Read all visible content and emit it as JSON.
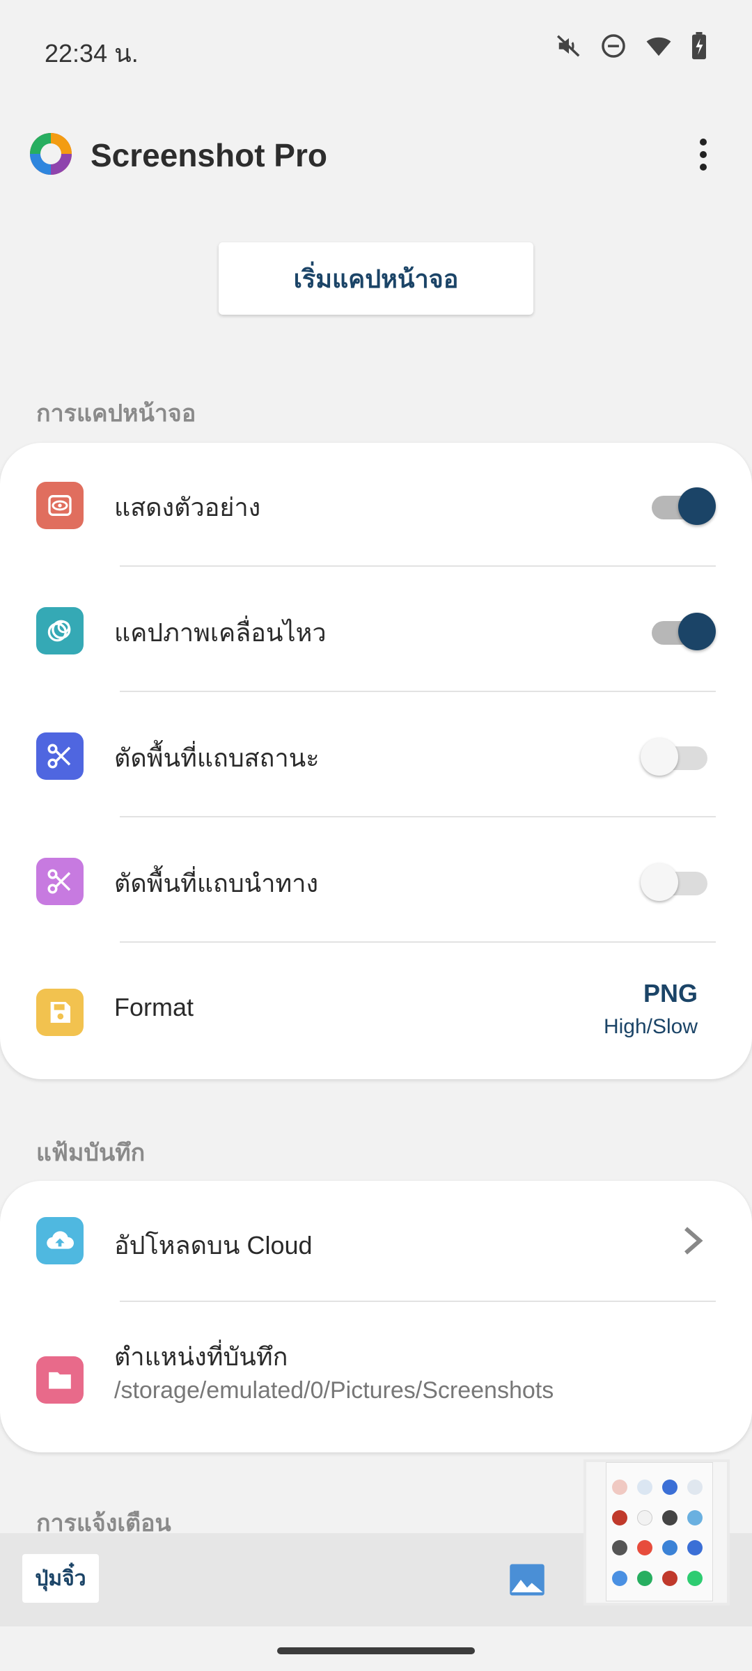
{
  "status_bar": {
    "time": "22:34 น.",
    "icons": [
      "mute-icon",
      "do-not-disturb-icon",
      "wifi-icon",
      "battery-charging-icon"
    ]
  },
  "app_bar": {
    "title": "Screenshot Pro",
    "menu_icon": "more-vert-icon"
  },
  "start_button": {
    "label": "เริ่มแคปหน้าจอ"
  },
  "sections": {
    "capture": {
      "header": "การแคปหน้าจอ",
      "rows": [
        {
          "label": "แสดงตัวอย่าง",
          "icon": "preview-eye-icon",
          "icon_color": "#e06e5e",
          "toggle": true
        },
        {
          "label": "แคปภาพเคลื่อนไหว",
          "icon": "rings-icon",
          "icon_color": "#35a9b5",
          "toggle": true
        },
        {
          "label": "ตัดพื้นที่แถบสถานะ",
          "icon": "scissors-icon",
          "icon_color": "#4f66e0",
          "toggle": false
        },
        {
          "label": "ตัดพื้นที่แถบนำทาง",
          "icon": "scissors-icon",
          "icon_color": "#c77ae0",
          "toggle": false
        }
      ],
      "format": {
        "label": "Format",
        "icon": "save-icon",
        "icon_color": "#f2c24f",
        "value": "PNG",
        "quality": "High/Slow"
      }
    },
    "save_folder": {
      "header": "แฟ้มบันทึก",
      "upload": {
        "label": "อัปโหลดบน Cloud",
        "icon": "cloud-upload-icon",
        "icon_color": "#4fb8e0"
      },
      "location": {
        "label": "ตำแหน่งที่บันทึก",
        "path": "/storage/emulated/0/Pictures/Screenshots",
        "icon": "folder-icon",
        "icon_color": "#e86a8a"
      }
    },
    "notifications": {
      "header": "การแจ้งเตือน"
    }
  },
  "bottom_bar": {
    "float_button": "ปุ่มจิ๋ว",
    "gallery_icon": "image-icon"
  },
  "colors": {
    "accent": "#1b4467",
    "background": "#f2f2f2"
  }
}
